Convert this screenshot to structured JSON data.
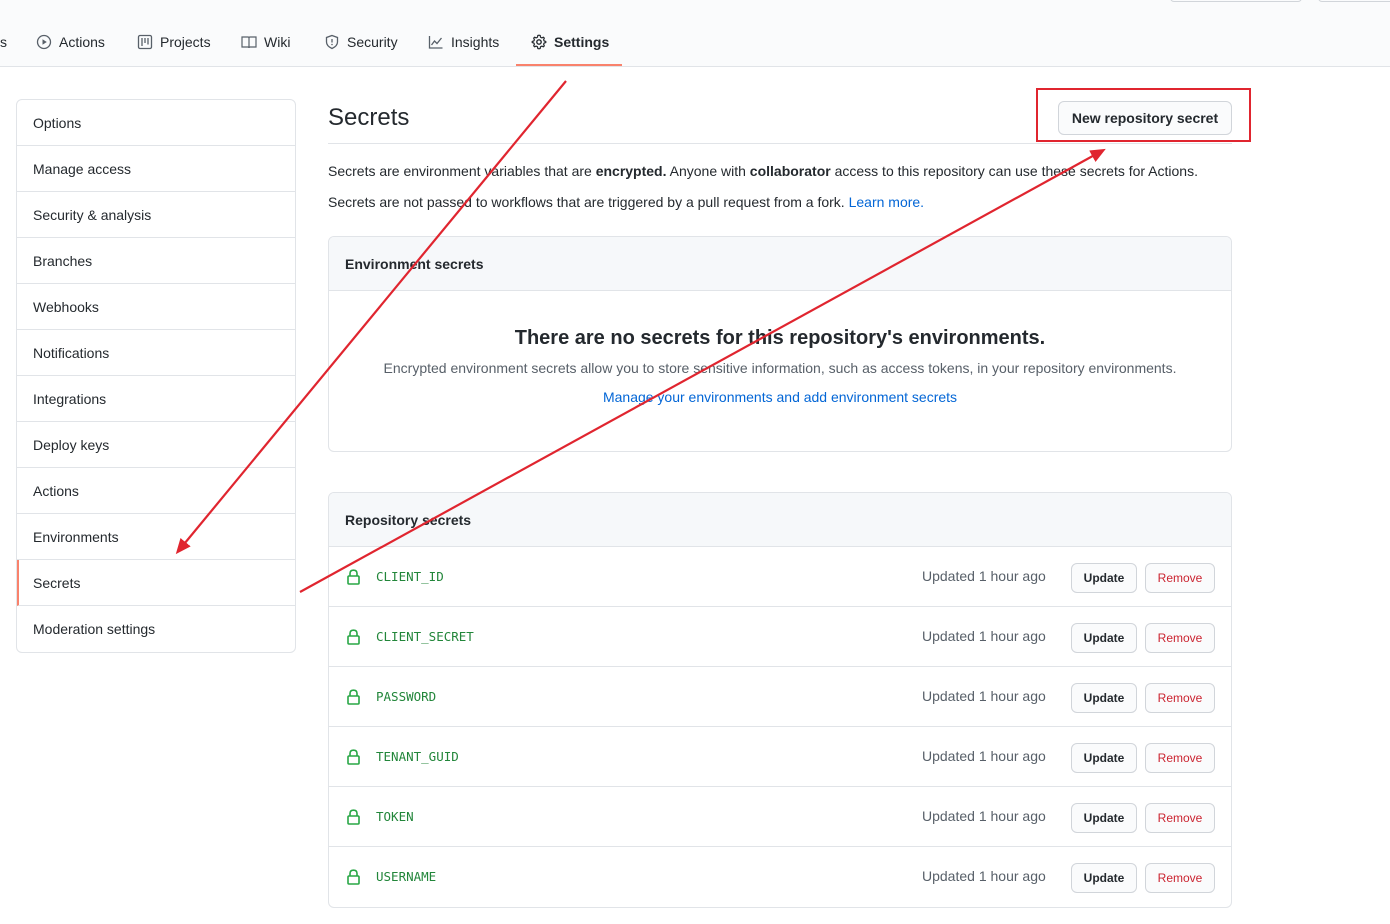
{
  "nav": {
    "fragment": "s",
    "tabs": [
      {
        "label": "Actions",
        "icon": "play-icon"
      },
      {
        "label": "Projects",
        "icon": "project-icon"
      },
      {
        "label": "Wiki",
        "icon": "book-icon"
      },
      {
        "label": "Security",
        "icon": "shield-icon"
      },
      {
        "label": "Insights",
        "icon": "graph-icon"
      },
      {
        "label": "Settings",
        "icon": "gear-icon",
        "selected": true
      }
    ]
  },
  "sidebar": {
    "items": [
      {
        "label": "Options"
      },
      {
        "label": "Manage access"
      },
      {
        "label": "Security & analysis"
      },
      {
        "label": "Branches"
      },
      {
        "label": "Webhooks"
      },
      {
        "label": "Notifications"
      },
      {
        "label": "Integrations"
      },
      {
        "label": "Deploy keys"
      },
      {
        "label": "Actions"
      },
      {
        "label": "Environments"
      },
      {
        "label": "Secrets",
        "selected": true
      },
      {
        "label": "Moderation settings"
      }
    ]
  },
  "main": {
    "title": "Secrets",
    "new_button": "New repository secret",
    "desc1": {
      "part1": "Secrets are environment variables that are ",
      "bold1": "encrypted.",
      "part2": " Anyone with ",
      "bold2": "collaborator",
      "part3": " access to this repository can use these secrets for Actions."
    },
    "desc2": {
      "text": "Secrets are not passed to workflows that are triggered by a pull request from a fork. ",
      "link": "Learn more."
    },
    "env": {
      "header": "Environment secrets",
      "heading": "There are no secrets for this repository's environments.",
      "text": "Encrypted environment secrets allow you to store sensitive information, such as access tokens, in your repository environments.",
      "link": "Manage your environments and add environment secrets"
    },
    "repo": {
      "header": "Repository secrets",
      "update_label": "Update",
      "remove_label": "Remove",
      "secrets": [
        {
          "name": "CLIENT_ID",
          "updated": "Updated 1 hour ago"
        },
        {
          "name": "CLIENT_SECRET",
          "updated": "Updated 1 hour ago"
        },
        {
          "name": "PASSWORD",
          "updated": "Updated 1 hour ago"
        },
        {
          "name": "TENANT_GUID",
          "updated": "Updated 1 hour ago"
        },
        {
          "name": "TOKEN",
          "updated": "Updated 1 hour ago"
        },
        {
          "name": "USERNAME",
          "updated": "Updated 1 hour ago"
        }
      ]
    }
  },
  "colors": {
    "accent_underline": "#f9826c",
    "annotation_red": "#e0252f",
    "link": "#0366d6",
    "secret_name": "#22863a",
    "danger": "#cb2431"
  }
}
